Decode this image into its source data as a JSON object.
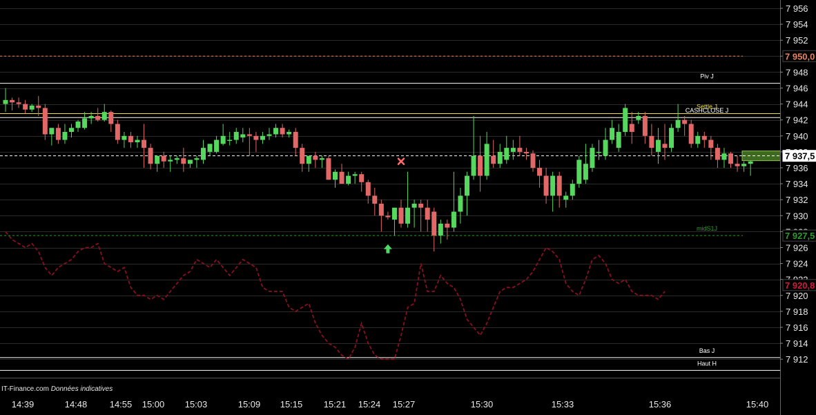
{
  "source": {
    "site": "IT-Finance.com",
    "note": "Données indicatives"
  },
  "chart_data": {
    "type": "candlestick",
    "y_ticks": [
      "7 956",
      "7 954",
      "7 952",
      "7 950",
      "7 948",
      "7 946",
      "7 944",
      "7 942",
      "7 940",
      "7 938",
      "7 936",
      "7 934",
      "7 932",
      "7 930",
      "7 928",
      "7 926",
      "7 924",
      "7 922",
      "7 920",
      "7 918",
      "7 916",
      "7 914",
      "7 912"
    ],
    "ylim": [
      7911,
      7957
    ],
    "x_ticks": [
      "14:39",
      "14:48",
      "14:55",
      "15:00",
      "15:03",
      "15:09",
      "15:15",
      "15:21",
      "15:24",
      "15:27",
      "15:30",
      "15:33",
      "15:36",
      "15:40"
    ],
    "levels": [
      {
        "label": "",
        "value": 7950.0,
        "tag": "7 950,0",
        "color": "#e8825c",
        "style": "dotted"
      },
      {
        "label": "Piv J",
        "value": 7946.6,
        "tag": "",
        "color": "#ffffff",
        "style": "solid"
      },
      {
        "label": "Settle J",
        "value": 7942.8,
        "tag": "",
        "color": "#f0e040",
        "style": "solid"
      },
      {
        "label": "CASHCLOSE J",
        "value": 7942.3,
        "tag": "",
        "color": "#ffffff",
        "style": "solid"
      },
      {
        "label": "",
        "value": 7937.5,
        "tag": "7 937,5",
        "color": "#ffffff",
        "style": "dashed"
      },
      {
        "label": "midS1J",
        "value": 7927.5,
        "tag": "7 927,5",
        "color": "#2e9a2e",
        "style": "dotted"
      },
      {
        "label": "Bas J",
        "value": 7912.2,
        "tag": "",
        "color": "#ffffff",
        "style": "solid"
      },
      {
        "label": "Haut H",
        "value": 7910.6,
        "tag": "",
        "color": "#ffffff",
        "style": "solid"
      }
    ],
    "indicator": {
      "tag": "7 920,8",
      "color": "#8a1020",
      "values": [
        7928,
        7927,
        7926.5,
        7926,
        7926.5,
        7925.5,
        7923.5,
        7922.5,
        7923.5,
        7924,
        7924.5,
        7925.5,
        7926,
        7926,
        7926.5,
        7924,
        7923.5,
        7923,
        7923.5,
        7921,
        7920,
        7920,
        7919.5,
        7920,
        7919.5,
        7920.5,
        7921.5,
        7922.5,
        7923,
        7924.5,
        7924,
        7923.5,
        7924.5,
        7923.5,
        7922.5,
        7923.5,
        7924.5,
        7924,
        7923.5,
        7921,
        7920.5,
        7920.5,
        7920.5,
        7918.5,
        7918,
        7918.5,
        7919,
        7916.5,
        7915,
        7914,
        7913.5,
        7912.5,
        7912,
        7913.5,
        7916.5,
        7914,
        7912.5,
        7912,
        7912,
        7912,
        7915,
        7918.5,
        7919,
        7924,
        7920.5,
        7920.5,
        7922.5,
        7921.5,
        7921,
        7919.5,
        7917,
        7916,
        7915,
        7916.5,
        7918.5,
        7920.5,
        7921,
        7921,
        7921.5,
        7922,
        7923,
        7924.5,
        7926,
        7925.5,
        7924.5,
        7921.5,
        7920.5,
        7920,
        7922,
        7924.5,
        7925,
        7924,
        7922,
        7921.5,
        7922,
        7920.5,
        7920,
        7920,
        7920,
        7919.5,
        7920.5
      ]
    },
    "candles": [
      [
        7944.0,
        7946.0,
        7943.0,
        7944.5
      ],
      [
        7944.5,
        7944.8,
        7943.2,
        7944.2
      ],
      [
        7944.2,
        7944.8,
        7943.5,
        7944.0
      ],
      [
        7944.0,
        7944.5,
        7942.8,
        7943.3
      ],
      [
        7943.3,
        7944.0,
        7943.0,
        7943.8
      ],
      [
        7943.8,
        7945.0,
        7942.5,
        7943.5
      ],
      [
        7943.5,
        7944.0,
        7939.5,
        7940.2
      ],
      [
        7940.2,
        7941.0,
        7938.8,
        7941.0
      ],
      [
        7941.0,
        7941.5,
        7939.0,
        7939.5
      ],
      [
        7939.5,
        7941.5,
        7939.0,
        7940.5
      ],
      [
        7940.5,
        7941.5,
        7939.8,
        7941.0
      ],
      [
        7941.0,
        7942.0,
        7940.5,
        7941.8
      ],
      [
        7941.0,
        7943.0,
        7940.8,
        7942.2
      ],
      [
        7942.2,
        7943.0,
        7941.5,
        7942.5
      ],
      [
        7942.5,
        7943.5,
        7941.8,
        7942.0
      ],
      [
        7942.0,
        7944.0,
        7941.8,
        7943.0
      ],
      [
        7943.0,
        7943.2,
        7940.5,
        7941.5
      ],
      [
        7941.5,
        7942.0,
        7939.0,
        7939.5
      ],
      [
        7939.5,
        7940.5,
        7938.5,
        7940.0
      ],
      [
        7940.0,
        7940.5,
        7938.5,
        7939.2
      ],
      [
        7939.2,
        7940.0,
        7938.5,
        7939.5
      ],
      [
        7939.5,
        7941.5,
        7936.0,
        7938.5
      ],
      [
        7938.5,
        7939.0,
        7935.8,
        7936.5
      ],
      [
        7936.5,
        7937.5,
        7935.5,
        7937.5
      ],
      [
        7937.5,
        7938.0,
        7936.0,
        7936.8
      ],
      [
        7936.8,
        7937.5,
        7935.5,
        7937.0
      ],
      [
        7937.0,
        7937.5,
        7936.5,
        7937.2
      ],
      [
        7937.2,
        7938.5,
        7935.5,
        7936.5
      ],
      [
        7936.5,
        7937.0,
        7936.0,
        7937.0
      ],
      [
        7937.0,
        7937.5,
        7936.0,
        7937.2
      ],
      [
        7937.0,
        7939.5,
        7936.5,
        7938.5
      ],
      [
        7938.0,
        7939.0,
        7937.5,
        7939.0
      ],
      [
        7938.0,
        7940.0,
        7937.8,
        7939.5
      ],
      [
        7939.0,
        7941.5,
        7938.8,
        7940.0
      ],
      [
        7939.5,
        7940.5,
        7938.8,
        7939.5
      ],
      [
        7939.5,
        7941.0,
        7939.0,
        7940.5
      ],
      [
        7939.8,
        7941.0,
        7939.2,
        7940.2
      ],
      [
        7940.2,
        7941.0,
        7937.5,
        7940.0
      ],
      [
        7940.0,
        7940.5,
        7938.0,
        7939.5
      ],
      [
        7939.5,
        7940.5,
        7939.0,
        7940.0
      ],
      [
        7940.0,
        7941.0,
        7939.5,
        7940.2
      ],
      [
        7940.2,
        7941.5,
        7939.8,
        7941.0
      ],
      [
        7941.0,
        7941.5,
        7939.8,
        7940.2
      ],
      [
        7940.2,
        7940.8,
        7939.8,
        7940.5
      ],
      [
        7940.5,
        7941.0,
        7937.5,
        7938.5
      ],
      [
        7938.5,
        7939.0,
        7935.5,
        7936.5
      ],
      [
        7936.5,
        7937.5,
        7935.5,
        7937.5
      ],
      [
        7937.5,
        7938.0,
        7936.0,
        7937.0
      ],
      [
        7937.0,
        7937.5,
        7936.0,
        7937.2
      ],
      [
        7937.2,
        7937.5,
        7934.5,
        7934.5
      ],
      [
        7934.5,
        7935.8,
        7933.5,
        7935.5
      ],
      [
        7935.5,
        7936.5,
        7934.0,
        7934.0
      ],
      [
        7934.0,
        7935.5,
        7933.8,
        7935.0
      ],
      [
        7935.0,
        7935.5,
        7934.0,
        7935.2
      ],
      [
        7935.2,
        7935.5,
        7933.0,
        7934.2
      ],
      [
        7934.2,
        7934.5,
        7931.5,
        7932.5
      ],
      [
        7932.5,
        7933.5,
        7930.0,
        7931.5
      ],
      [
        7931.5,
        7932.0,
        7928.0,
        7930.0
      ],
      [
        7930.0,
        7930.5,
        7929.5,
        7929.8
      ],
      [
        7929.5,
        7931.0,
        7927.5,
        7931.0
      ],
      [
        7931.0,
        7932.0,
        7928.5,
        7929.0
      ],
      [
        7929.0,
        7935.5,
        7928.5,
        7931.0
      ],
      [
        7931.0,
        7932.0,
        7928.5,
        7931.5
      ],
      [
        7931.5,
        7932.0,
        7928.0,
        7931.0
      ],
      [
        7931.0,
        7932.0,
        7928.0,
        7929.5
      ],
      [
        7930.5,
        7931.0,
        7925.5,
        7927.5
      ],
      [
        7927.5,
        7929.5,
        7926.5,
        7929.0
      ],
      [
        7929.0,
        7929.5,
        7927.0,
        7928.5
      ],
      [
        7928.5,
        7935.5,
        7928.0,
        7930.5
      ],
      [
        7930.5,
        7933.5,
        7929.0,
        7932.5
      ],
      [
        7932.5,
        7935.5,
        7930.0,
        7935.0
      ],
      [
        7935.0,
        7942.5,
        7934.5,
        7937.5
      ],
      [
        7937.5,
        7940.0,
        7933.0,
        7935.0
      ],
      [
        7935.0,
        7940.5,
        7934.5,
        7939.0
      ],
      [
        7937.5,
        7939.5,
        7936.0,
        7936.5
      ],
      [
        7936.5,
        7939.0,
        7936.0,
        7938.0
      ],
      [
        7937.0,
        7940.0,
        7936.5,
        7938.5
      ],
      [
        7938.0,
        7939.5,
        7937.0,
        7938.5
      ],
      [
        7938.5,
        7940.0,
        7937.5,
        7938.0
      ],
      [
        7938.0,
        7938.5,
        7937.0,
        7937.8
      ],
      [
        7937.8,
        7938.2,
        7935.5,
        7936.0
      ],
      [
        7936.0,
        7937.0,
        7933.5,
        7935.0
      ],
      [
        7935.0,
        7936.0,
        7931.5,
        7932.5
      ],
      [
        7932.5,
        7935.5,
        7930.5,
        7935.0
      ],
      [
        7935.0,
        7935.5,
        7931.0,
        7932.5
      ],
      [
        7932.0,
        7933.0,
        7931.0,
        7932.5
      ],
      [
        7932.5,
        7934.5,
        7932.0,
        7934.0
      ],
      [
        7934.0,
        7937.5,
        7933.5,
        7937.0
      ],
      [
        7934.5,
        7939.0,
        7934.0,
        7936.5
      ],
      [
        7936.0,
        7939.0,
        7935.5,
        7938.5
      ],
      [
        7938.0,
        7939.5,
        7937.0,
        7938.0
      ],
      [
        7937.5,
        7941.0,
        7937.0,
        7939.5
      ],
      [
        7939.5,
        7942.0,
        7939.0,
        7941.0
      ],
      [
        7938.5,
        7941.5,
        7938.0,
        7940.5
      ],
      [
        7940.5,
        7944.0,
        7940.0,
        7943.5
      ],
      [
        7941.5,
        7943.0,
        7939.0,
        7940.5
      ],
      [
        7942.0,
        7943.0,
        7941.5,
        7942.5
      ],
      [
        7942.5,
        7943.0,
        7939.0,
        7940.0
      ],
      [
        7940.0,
        7941.5,
        7937.5,
        7938.5
      ],
      [
        7938.0,
        7941.0,
        7936.5,
        7939.5
      ],
      [
        7939.0,
        7941.5,
        7937.0,
        7938.5
      ],
      [
        7938.5,
        7941.5,
        7938.0,
        7941.0
      ],
      [
        7941.0,
        7944.0,
        7940.5,
        7942.0
      ],
      [
        7942.0,
        7942.5,
        7940.0,
        7941.5
      ],
      [
        7941.5,
        7942.0,
        7938.5,
        7939.0
      ],
      [
        7939.0,
        7940.5,
        7938.5,
        7940.0
      ],
      [
        7940.0,
        7940.5,
        7938.5,
        7939.5
      ],
      [
        7939.5,
        7940.0,
        7937.0,
        7938.5
      ],
      [
        7938.5,
        7939.0,
        7936.0,
        7937.0
      ],
      [
        7937.0,
        7938.5,
        7936.0,
        7937.8
      ],
      [
        7937.8,
        7938.0,
        7936.0,
        7936.5
      ],
      [
        7936.5,
        7937.5,
        7935.5,
        7936.2
      ],
      [
        7936.2,
        7936.8,
        7935.5,
        7936.5
      ],
      [
        7936.5,
        7937.0,
        7935.0,
        7936.8
      ]
    ],
    "markers": [
      {
        "kind": "buy-arrow",
        "index": 58,
        "value": 7925.8,
        "color": "#4cd964"
      },
      {
        "kind": "sell-cross",
        "index": 60,
        "value": 7936.8,
        "color": "#ff6b6b"
      }
    ]
  }
}
